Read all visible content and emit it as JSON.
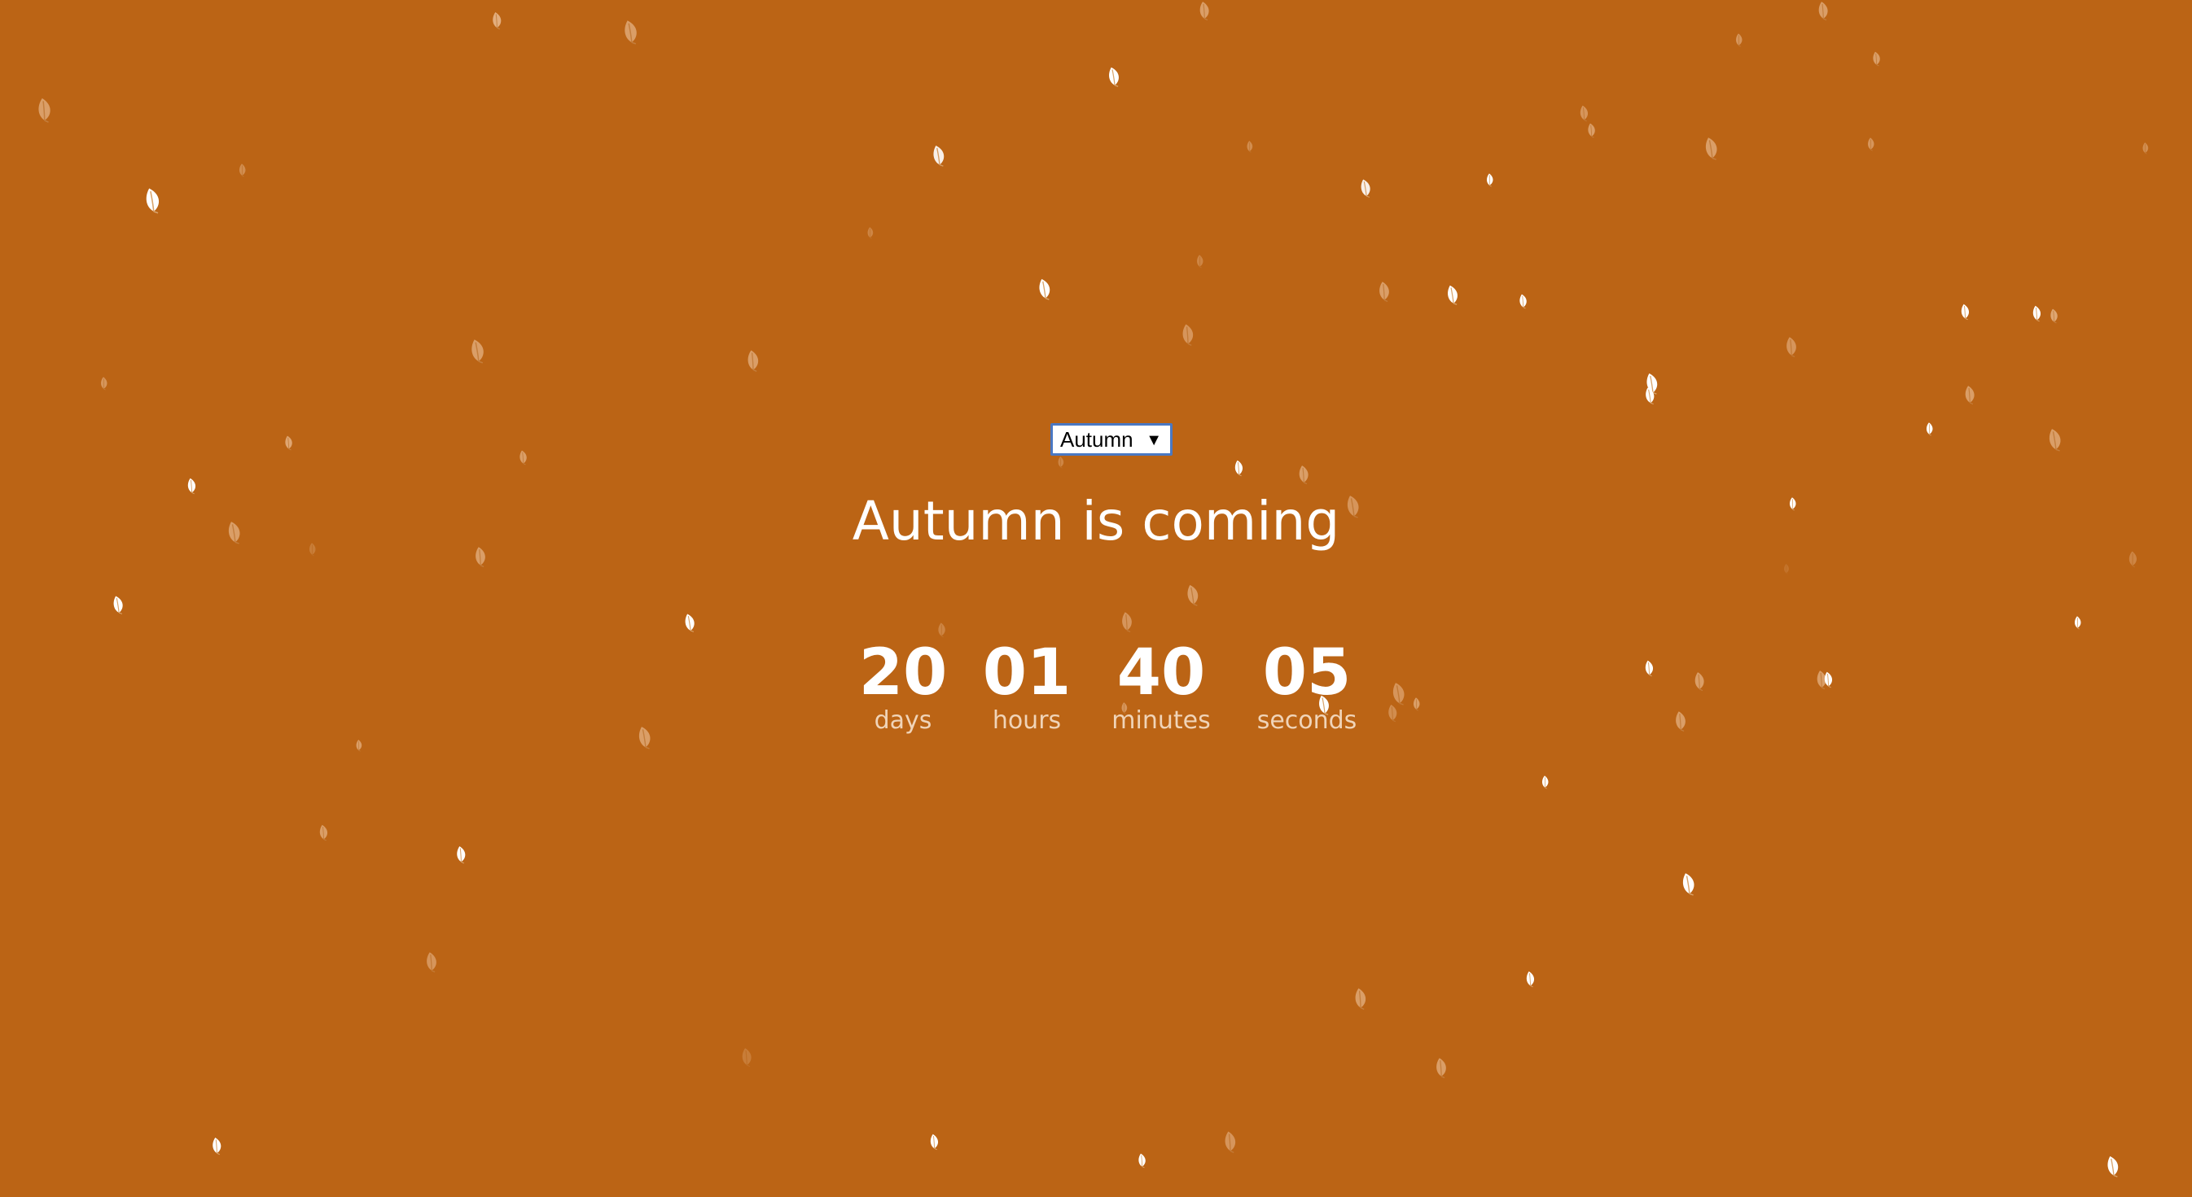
{
  "page": {
    "background_color": "#bb6415",
    "leaf_color_light": "#ffffff",
    "leaf_color_faded": "#e8b78a"
  },
  "season_select": {
    "selected": "Autumn",
    "arrow_icon": "triangle-down-icon"
  },
  "heading": {
    "title": "Autumn is coming"
  },
  "countdown": [
    {
      "value": "20",
      "label": "days"
    },
    {
      "value": "01",
      "label": "hours"
    },
    {
      "value": "40",
      "label": "minutes"
    },
    {
      "value": "05",
      "label": "seconds"
    }
  ]
}
